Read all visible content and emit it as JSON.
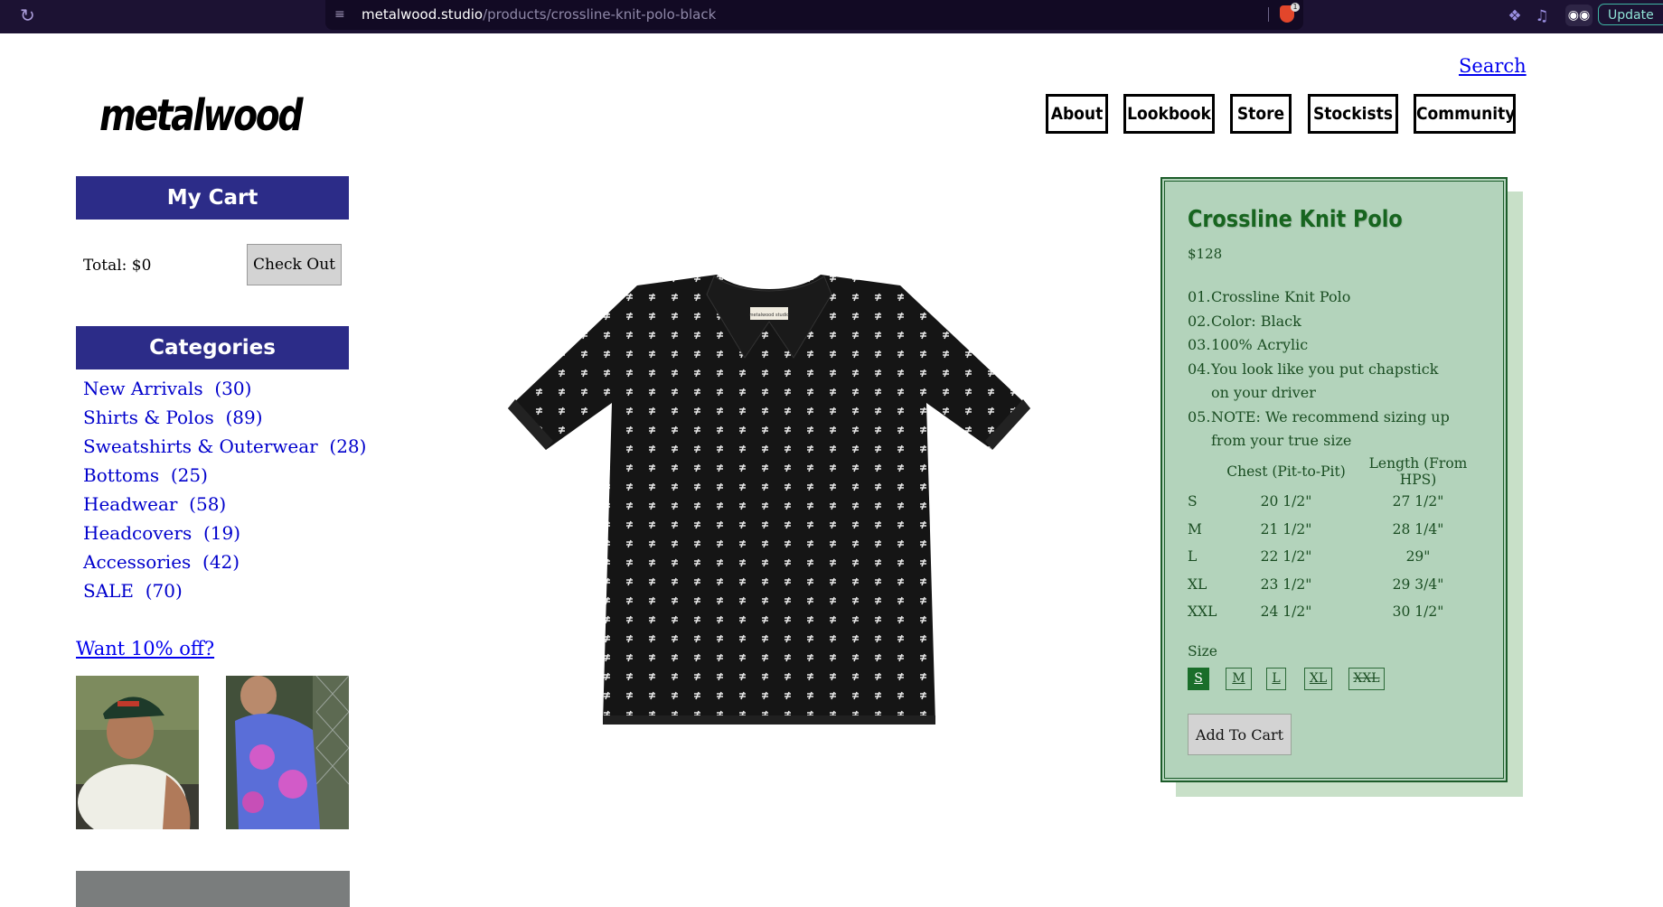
{
  "browser": {
    "url_host": "metalwood.studio",
    "url_path": "/products/crossline-knit-polo-black",
    "shield_badge": "1",
    "update_label": "Update"
  },
  "header": {
    "search_label": "Search",
    "logo_text": "metalwood",
    "nav": [
      "About",
      "Lookbook",
      "Store",
      "Stockists",
      "Community"
    ]
  },
  "cart": {
    "title": "My Cart",
    "total": "Total: $0",
    "checkout_label": "Check Out"
  },
  "categories": {
    "title": "Categories",
    "items": [
      {
        "label": "New Arrivals",
        "count": "(30)"
      },
      {
        "label": "Shirts & Polos",
        "count": "(89)"
      },
      {
        "label": "Sweatshirts & Outerwear",
        "count": "(28)"
      },
      {
        "label": "Bottoms",
        "count": "(25)"
      },
      {
        "label": "Headwear",
        "count": "(58)"
      },
      {
        "label": "Headcovers",
        "count": "(19)"
      },
      {
        "label": "Accessories",
        "count": "(42)"
      },
      {
        "label": "SALE",
        "count": "(70)"
      }
    ]
  },
  "promo": {
    "label": "Want 10% off?"
  },
  "product": {
    "title": "Crossline Knit Polo",
    "price": "$128",
    "features": [
      {
        "num": "01.",
        "text": "Crossline Knit Polo"
      },
      {
        "num": "02.",
        "text": "Color: Black"
      },
      {
        "num": "03.",
        "text": "100% Acrylic"
      },
      {
        "num": "04.",
        "text": "You look like you put chapstick on your driver"
      },
      {
        "num": "05.",
        "text": "NOTE: We recommend sizing up from your true size"
      }
    ],
    "size_chart": {
      "headers": [
        "",
        "Chest (Pit-to-Pit)",
        "Length (From HPS)"
      ],
      "rows": [
        [
          "S",
          "20 1/2\"",
          "27 1/2\""
        ],
        [
          "M",
          "21 1/2\"",
          "28 1/4\""
        ],
        [
          "L",
          "22 1/2\"",
          "29\""
        ],
        [
          "XL",
          "23 1/2\"",
          "29 3/4\""
        ],
        [
          "XXL",
          "24 1/2\"",
          "30 1/2\""
        ]
      ]
    },
    "size_label": "Size",
    "sizes": [
      {
        "label": "S",
        "selected": true,
        "available": true
      },
      {
        "label": "M",
        "selected": false,
        "available": true
      },
      {
        "label": "L",
        "selected": false,
        "available": true
      },
      {
        "label": "XL",
        "selected": false,
        "available": true
      },
      {
        "label": "XXL",
        "selected": false,
        "available": false
      }
    ],
    "add_to_cart_label": "Add To Cart",
    "tag_text": "metalwood studio"
  },
  "colors": {
    "chrome_bg": "#1c1233",
    "sidebar_header": "#2c2c88",
    "link": "#0000ee",
    "panel_bg": "#b3d3bb",
    "panel_text": "#1a4d22",
    "title_green": "#17651f"
  }
}
